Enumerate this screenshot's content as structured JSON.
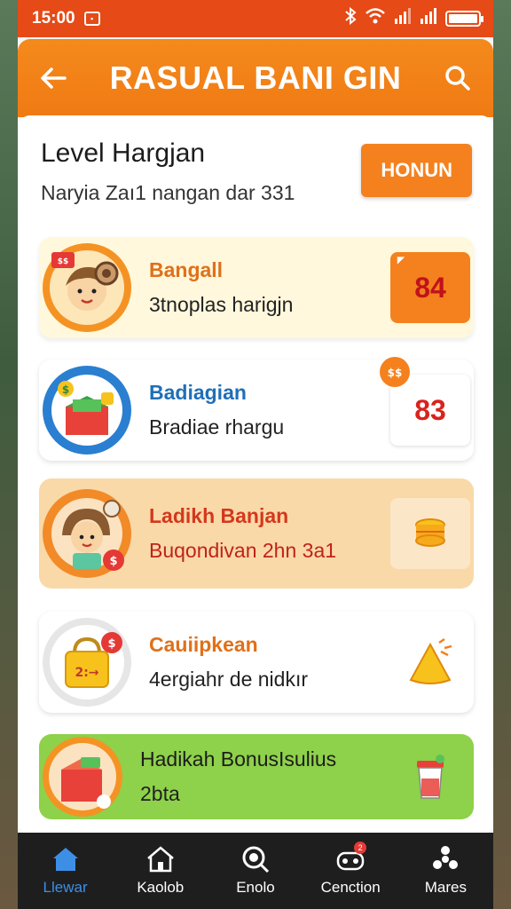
{
  "status_bar": {
    "time": "15:00"
  },
  "app_bar": {
    "title": "RASUAL BANI GIN"
  },
  "level": {
    "title": "Level Hargjan",
    "subtitle": "Naryia Zaı1 nangan dar 331",
    "button_label": "HONUN"
  },
  "rows": [
    {
      "title": "Bangall",
      "subtitle": "3tnoplas harigjn",
      "score": "84",
      "title_color": "#e0701a"
    },
    {
      "title": "Badiagian",
      "subtitle": "Bradiae rhargu",
      "score": "83",
      "title_color": "#1f6fb8"
    },
    {
      "title": "Ladikh Banjan",
      "subtitle": "Buqondivan 2hn 3a1",
      "title_color": "#d4381c"
    },
    {
      "title": "Cauiipkean",
      "subtitle": "4ergiahr de nidkır",
      "title_color": "#e0701a"
    },
    {
      "title": "Hadikah BonusIsulius",
      "subtitle": "2bta",
      "title_color": "#1c1c1c"
    }
  ],
  "bottom_nav": [
    {
      "label": "Llewar",
      "icon": "home-icon",
      "active": true
    },
    {
      "label": "Kaolob",
      "icon": "house-outline-icon"
    },
    {
      "label": "Enolo",
      "icon": "search-icon"
    },
    {
      "label": "Cenction",
      "icon": "controller-icon",
      "badge": "2"
    },
    {
      "label": "Mares",
      "icon": "more-icon"
    }
  ],
  "colors": {
    "status_bar": "#e64a16",
    "app_bar": "#f48a1c",
    "accent_orange": "#f4811e",
    "score_red": "#d8231c",
    "nav_active": "#3d8fe6"
  }
}
